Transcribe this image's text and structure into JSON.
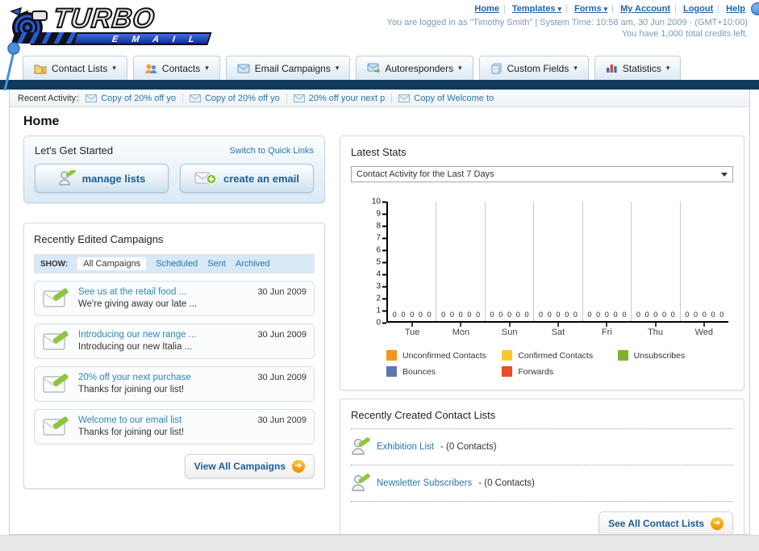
{
  "glyphs": {
    "caret": "▾",
    "button_arrow": "➜"
  },
  "header": {
    "logo": {
      "title": "TURBO",
      "subtitle": "E M A I L"
    },
    "separator": "|",
    "nav_links": [
      {
        "label": "Home",
        "dropdown": false
      },
      {
        "label": "Templates",
        "dropdown": true
      },
      {
        "label": "Forms",
        "dropdown": true
      },
      {
        "label": "My Account",
        "dropdown": false
      },
      {
        "label": "Logout",
        "dropdown": false
      },
      {
        "label": "Help",
        "dropdown": false
      }
    ],
    "login_status": "You are logged in as \"Timothy Smith\" | System Time: 10:58 am, 30 Jun 2009 - (GMT+10:00)",
    "credits": "You have 1,000 total credits left."
  },
  "tabs": [
    {
      "label": "Contact Lists"
    },
    {
      "label": "Contacts"
    },
    {
      "label": "Email Campaigns"
    },
    {
      "label": "Autoresponders"
    },
    {
      "label": "Custom Fields"
    },
    {
      "label": "Statistics"
    }
  ],
  "recent_activity": {
    "label": "Recent Activity:",
    "items": [
      {
        "label": "Copy of 20% off yo"
      },
      {
        "label": "Copy of 20% off yo"
      },
      {
        "label": "20% off your next p"
      },
      {
        "label": "Copy of Welcome to"
      }
    ]
  },
  "page_title": "Home",
  "get_started": {
    "title": "Let's Get Started",
    "switch_link": "Switch to Quick Links",
    "manage_lists_label": "manage lists",
    "create_email_label": "create an email"
  },
  "campaigns": {
    "title": "Recently Edited Campaigns",
    "show_label": "SHOW:",
    "filters": [
      {
        "label": "All Campaigns",
        "selected": true
      },
      {
        "label": "Scheduled",
        "selected": false
      },
      {
        "label": "Sent",
        "selected": false
      },
      {
        "label": "Archived",
        "selected": false
      }
    ],
    "items": [
      {
        "title": "See us at the retail food ...",
        "subtitle": "We're giving away our late ...",
        "date": "30 Jun 2009"
      },
      {
        "title": "Introducing our new range ...",
        "subtitle": "Introducing our new Italia ...",
        "date": "30 Jun 2009"
      },
      {
        "title": "20% off your next purchase",
        "subtitle": "Thanks for joining our list!",
        "date": "30 Jun 2009"
      },
      {
        "title": "Welcome to our email list",
        "subtitle": "Thanks for joining our list!",
        "date": "30 Jun 2009"
      }
    ],
    "view_all_label": "View All Campaigns"
  },
  "stats": {
    "title": "Latest Stats",
    "dropdown_value": "Contact Activity for the Last 7 Days"
  },
  "chart_data": {
    "type": "bar",
    "title": "Contact Activity for the Last 7 Days",
    "categories": [
      "Tue",
      "Mon",
      "Sun",
      "Sat",
      "Fri",
      "Thu",
      "Wed"
    ],
    "series": [
      {
        "name": "Unconfirmed Contacts",
        "color": "#F6941C",
        "values": [
          0,
          0,
          0,
          0,
          0,
          0,
          0
        ]
      },
      {
        "name": "Confirmed Contacts",
        "color": "#FBC92D",
        "values": [
          0,
          0,
          0,
          0,
          0,
          0,
          0
        ]
      },
      {
        "name": "Unsubscribes",
        "color": "#7CB32A",
        "values": [
          0,
          0,
          0,
          0,
          0,
          0,
          0
        ]
      },
      {
        "name": "Bounces",
        "color": "#5B76B0",
        "values": [
          0,
          0,
          0,
          0,
          0,
          0,
          0
        ]
      },
      {
        "name": "Forwards",
        "color": "#E64F2A",
        "values": [
          0,
          0,
          0,
          0,
          0,
          0,
          0
        ]
      }
    ],
    "xlabel": "",
    "ylabel": "",
    "ylim": [
      0,
      10
    ],
    "yticks": [
      0,
      1,
      2,
      3,
      4,
      5,
      6,
      7,
      8,
      9,
      10
    ],
    "grid": "vertical-between-groups",
    "legend_position": "bottom"
  },
  "contact_lists": {
    "title": "Recently Created Contact Lists",
    "items": [
      {
        "name": "Exhibition List",
        "count": "- (0 Contacts)"
      },
      {
        "name": "Newsletter Subscribers",
        "count": "- (0 Contacts)"
      }
    ],
    "see_all_label": "See All Contact Lists"
  }
}
